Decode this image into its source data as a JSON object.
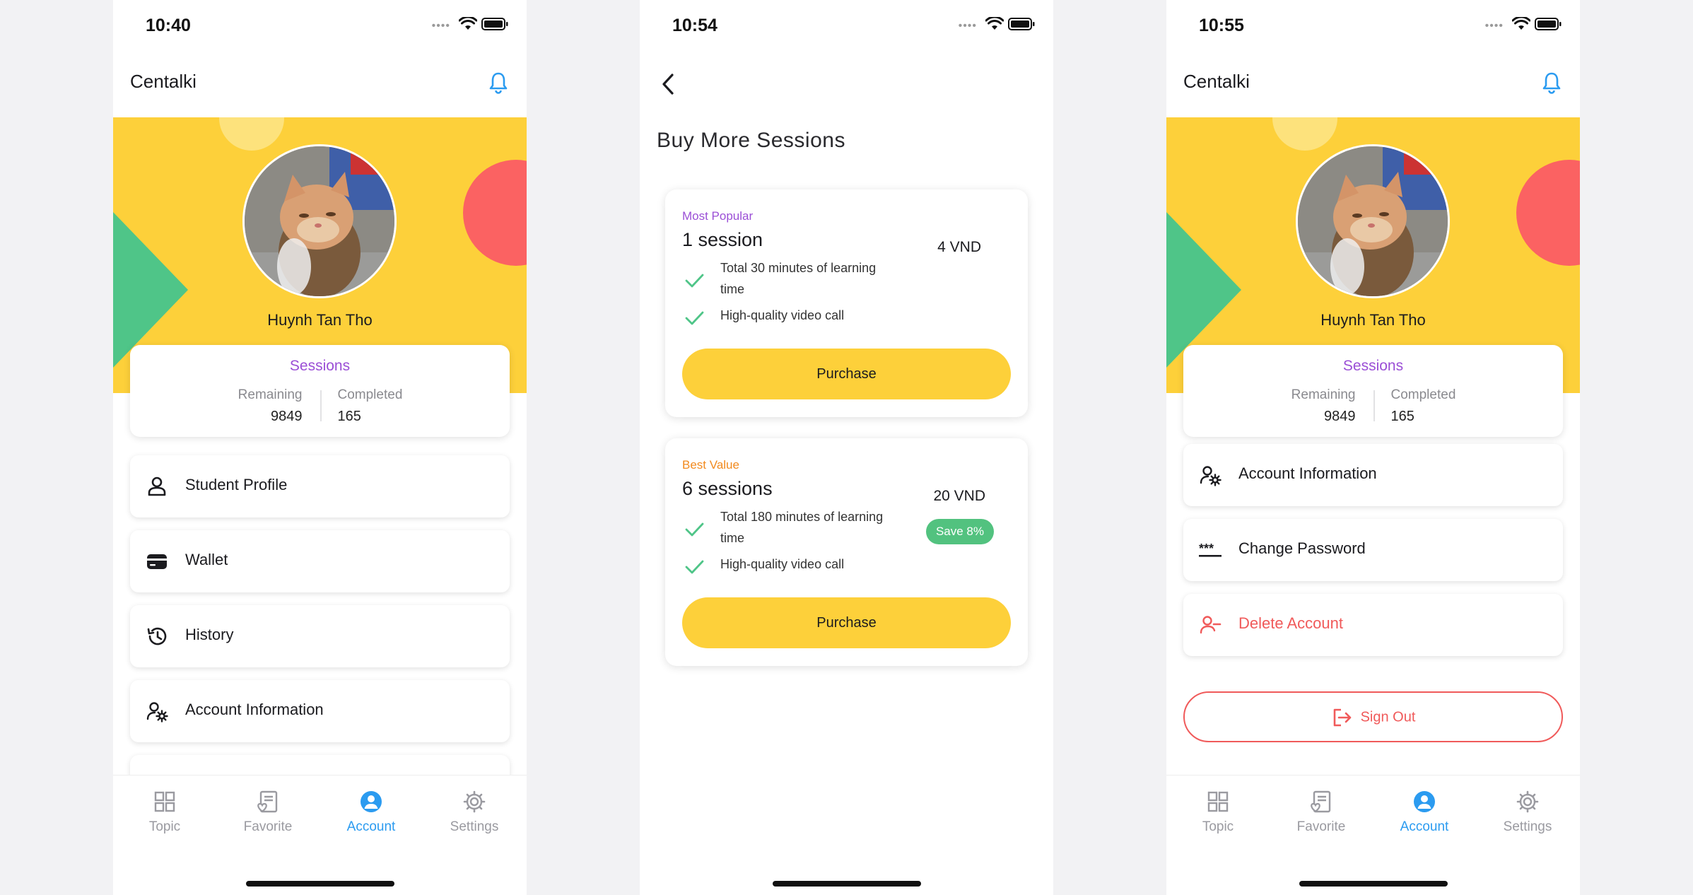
{
  "colors": {
    "accent": "#2b9bf0",
    "banner": "#fdd03a",
    "purple": "#9b4fd6",
    "danger": "#f05a5a",
    "green": "#4fc588",
    "coral": "#fb6262",
    "orange": "#f28a1e"
  },
  "screens": {
    "account": {
      "status_time": "10:40",
      "title": "Centalki",
      "user_name": "Huynh Tan Tho",
      "sessions": {
        "title": "Sessions",
        "remaining_label": "Remaining",
        "remaining_value": "9849",
        "completed_label": "Completed",
        "completed_value": "165"
      },
      "menu": [
        {
          "label": "Student Profile",
          "icon": "person-icon"
        },
        {
          "label": "Wallet",
          "icon": "wallet-icon"
        },
        {
          "label": "History",
          "icon": "history-icon"
        },
        {
          "label": "Account Information",
          "icon": "user-gear-icon"
        }
      ]
    },
    "buy": {
      "status_time": "10:54",
      "title": "Buy More Sessions",
      "packages": [
        {
          "tag": "Most Popular",
          "name": "1 session",
          "price": "4 VND",
          "features": [
            "Total 30 minutes of learning time",
            "High-quality video call"
          ],
          "button": "Purchase"
        },
        {
          "tag": "Best Value",
          "name": "6 sessions",
          "price": "20 VND",
          "badge": "Save 8%",
          "features": [
            "Total 180 minutes of learning time",
            "High-quality video call"
          ],
          "button": "Purchase"
        }
      ]
    },
    "settings": {
      "status_time": "10:55",
      "title": "Centalki",
      "user_name": "Huynh Tan Tho",
      "sessions": {
        "title": "Sessions",
        "remaining_label": "Remaining",
        "remaining_value": "9849",
        "completed_label": "Completed",
        "completed_value": "165"
      },
      "menu": [
        {
          "label": "Account Information",
          "icon": "user-gear-icon"
        },
        {
          "label": "Change Password",
          "icon": "password-icon"
        },
        {
          "label": "Delete Account",
          "icon": "user-minus-icon"
        }
      ],
      "signout": "Sign Out"
    }
  },
  "tabs": [
    {
      "label": "Topic",
      "icon": "grid-icon"
    },
    {
      "label": "Favorite",
      "icon": "favorite-list-icon"
    },
    {
      "label": "Account",
      "icon": "account-icon",
      "active": true
    },
    {
      "label": "Settings",
      "icon": "gear-icon"
    }
  ]
}
